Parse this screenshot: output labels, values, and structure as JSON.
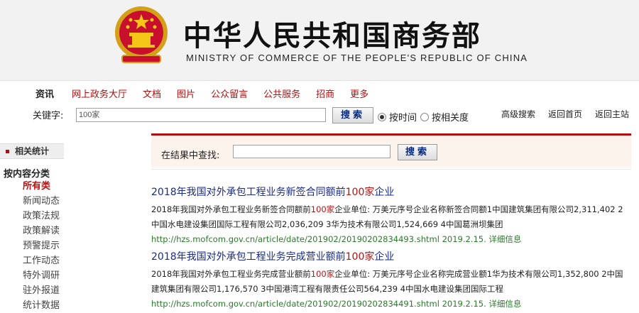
{
  "header": {
    "title_cn": "中华人民共和国商务部",
    "title_en": "MINISTRY OF COMMERCE OF THE PEOPLE'S REPUBLIC OF CHINA",
    "emblem_icon": "national-emblem-icon"
  },
  "nav": {
    "items": [
      "资讯",
      "网上政务大厅",
      "文档",
      "图片",
      "公众留言",
      "公共服务",
      "招商",
      "更多"
    ],
    "keyword_label": "关键字:",
    "keyword_value": "100家",
    "search_label": "搜索",
    "radio_time_label": "按时间",
    "radio_relevance_label": "按相关度",
    "advanced_search": "高级搜索",
    "back_home": "返回首页",
    "back_main": "返回主站"
  },
  "sidebar": {
    "header": "相关统计",
    "category_title": "按内容分类",
    "items": [
      "所有类",
      "新闻动态",
      "政策法规",
      "政策解读",
      "预警提示",
      "工作动态",
      "特外调研",
      "驻外报道",
      "统计数据"
    ]
  },
  "refine": {
    "label": "在结果中查找:",
    "input_value": "",
    "button_label": "搜索"
  },
  "results": [
    {
      "title_pre": "2018年我国对外承包工程业务新签合同额前",
      "title_hl": "100家",
      "title_post": "企业",
      "snippet_pre": "2018年我国对外承包工程业务新签合同额前",
      "snippet_hl": "100家",
      "snippet_post": "企业单位: 万美元序号企业名称新签合同额1中国建筑集团有限公司2,311,402 2中国水电建设集团国际工程有限公司2,036,209 3华为技术有限公司1,524,669 4中国葛洲坝集团",
      "url": "http://hzs.mofcom.gov.cn/article/date/201902/20190202834493.shtml",
      "date": "2019.2.15.",
      "info": "详细信息"
    },
    {
      "title_pre": "2018年我国对外承包工程业务完成营业额前",
      "title_hl": "100家",
      "title_post": "企业",
      "snippet_pre": "2018年我国对外承包工程业务完成营业额前",
      "snippet_hl": "100家",
      "snippet_post": "企业单位: 万美元序号企业名称完成营业额1华为技术有限公司1,352,800 2中国建筑集团有限公司1,176,570 3中国港湾工程有限责任公司564,239 4中国水电建设集团国际工程",
      "url": "http://hzs.mofcom.gov.cn/article/date/201902/20190202834491.shtml",
      "date": "2019.2.15.",
      "info": "详细信息"
    }
  ],
  "colors": {
    "accent_red": "#b01010",
    "link_blue": "#1a2a8a",
    "url_green": "#2a7a2a"
  }
}
